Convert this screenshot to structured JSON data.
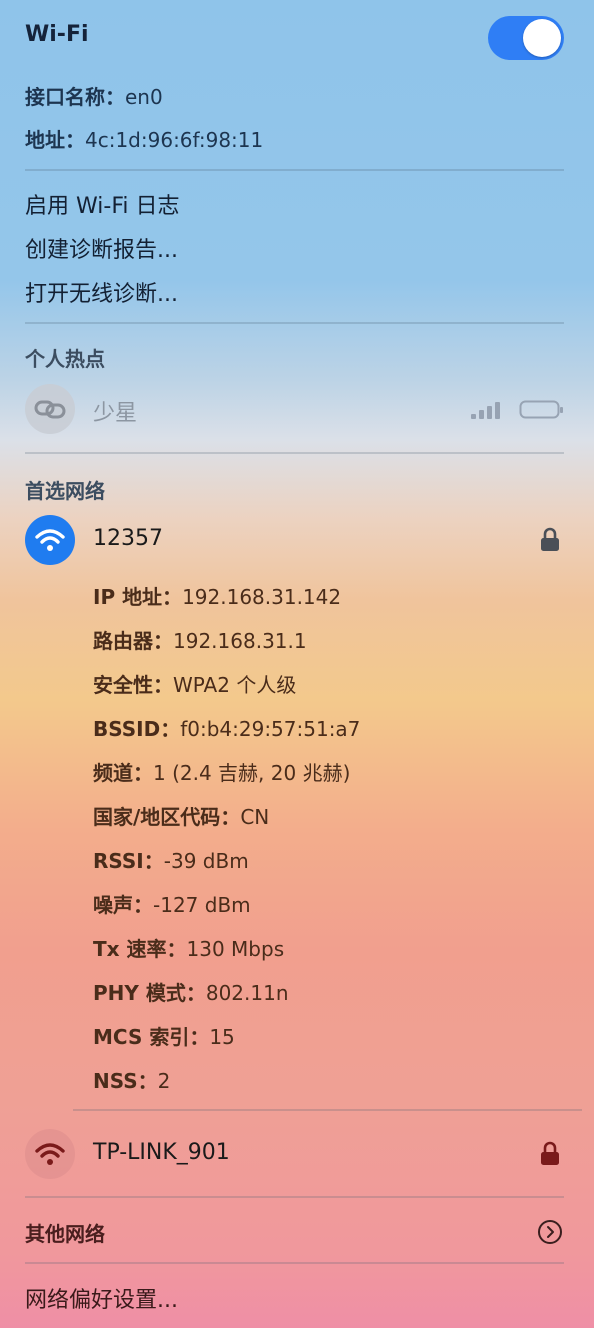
{
  "header": {
    "title": "Wi-Fi",
    "toggle_on": true,
    "interface_label": "接口名称：",
    "interface_value": "en0",
    "address_label": "地址：",
    "address_value": "4c:1d:96:6f:98:11"
  },
  "menu": {
    "log": "启用 Wi-Fi 日志",
    "diag_report": "创建诊断报告...",
    "wireless_diag": "打开无线诊断..."
  },
  "hotspot": {
    "section": "个人热点",
    "device_name": "少星",
    "icon": "link-icon"
  },
  "preferred": {
    "section": "首选网络",
    "network_name": "12357",
    "details": [
      {
        "label": "IP 地址：",
        "value": "192.168.31.142"
      },
      {
        "label": "路由器：",
        "value": "192.168.31.1"
      },
      {
        "label": "安全性：",
        "value": "WPA2 个人级"
      },
      {
        "label": "BSSID：",
        "value": "f0:b4:29:57:51:a7"
      },
      {
        "label": "频道：",
        "value": "1 (2.4 吉赫, 20 兆赫)"
      },
      {
        "label": "国家/地区代码：",
        "value": "CN"
      },
      {
        "label": "RSSI：",
        "value": "-39 dBm"
      },
      {
        "label": "噪声：",
        "value": "-127 dBm"
      },
      {
        "label": "Tx 速率：",
        "value": "130 Mbps"
      },
      {
        "label": "PHY 模式：",
        "value": "802.11n"
      },
      {
        "label": "MCS 索引：",
        "value": "15"
      },
      {
        "label": "NSS：",
        "value": "2"
      }
    ]
  },
  "other_saved": {
    "network_name": "TP-LINK_901"
  },
  "other_networks": "其他网络",
  "preferences": "网络偏好设置...",
  "colors": {
    "accent": "#2f7ef5",
    "wifi_circle_active": "#1f7cf0",
    "wifi_icon_dark": "#7a1a1a"
  }
}
